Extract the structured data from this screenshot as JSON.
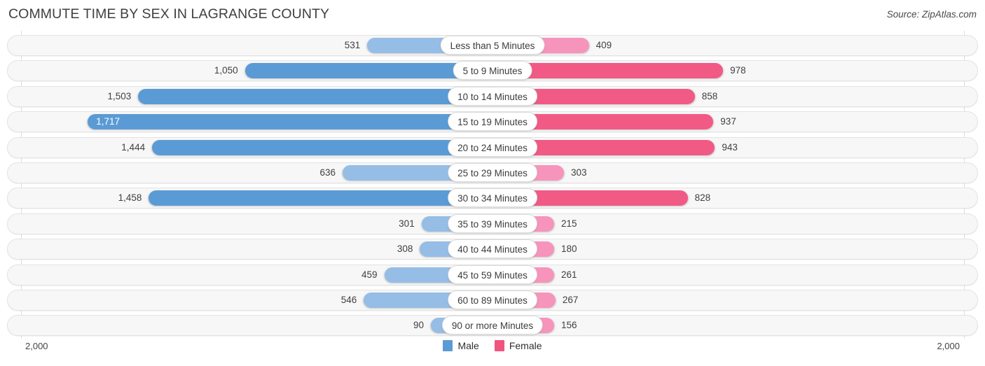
{
  "header": {
    "title": "COMMUTE TIME BY SEX IN LAGRANGE COUNTY",
    "source": "Source: ZipAtlas.com"
  },
  "axis": {
    "left_label": "2,000",
    "right_label": "2,000",
    "max": 2000
  },
  "legend": {
    "items": [
      {
        "label": "Male",
        "color": "#5b9bd5"
      },
      {
        "label": "Female",
        "color": "#f1557f"
      }
    ]
  },
  "colors": {
    "male_strong": "#5b9bd5",
    "male_light": "#95bde6",
    "female_strong": "#f15a85",
    "female_light": "#f794bb",
    "track": "#f7f7f7",
    "gridline": "#d8dde3"
  },
  "chart_data": {
    "type": "bar",
    "title": "COMMUTE TIME BY SEX IN LAGRANGE COUNTY",
    "xlabel": "",
    "ylabel": "",
    "orientation": "horizontal-diverging",
    "xlim": [
      2000,
      2000
    ],
    "grid": true,
    "legend_position": "bottom-center",
    "categories": [
      "Less than 5 Minutes",
      "5 to 9 Minutes",
      "10 to 14 Minutes",
      "15 to 19 Minutes",
      "20 to 24 Minutes",
      "25 to 29 Minutes",
      "30 to 34 Minutes",
      "35 to 39 Minutes",
      "40 to 44 Minutes",
      "45 to 59 Minutes",
      "60 to 89 Minutes",
      "90 or more Minutes"
    ],
    "series": [
      {
        "name": "Male",
        "values": [
          531,
          1050,
          1503,
          1717,
          1444,
          636,
          1458,
          301,
          308,
          459,
          546,
          90
        ],
        "labels": [
          "531",
          "1,050",
          "1,503",
          "1,717",
          "1,444",
          "636",
          "1,458",
          "301",
          "308",
          "459",
          "546",
          "90"
        ]
      },
      {
        "name": "Female",
        "values": [
          409,
          978,
          858,
          937,
          943,
          303,
          828,
          215,
          180,
          261,
          267,
          156
        ],
        "labels": [
          "409",
          "978",
          "858",
          "937",
          "943",
          "303",
          "828",
          "215",
          "180",
          "261",
          "267",
          "156"
        ]
      }
    ]
  }
}
